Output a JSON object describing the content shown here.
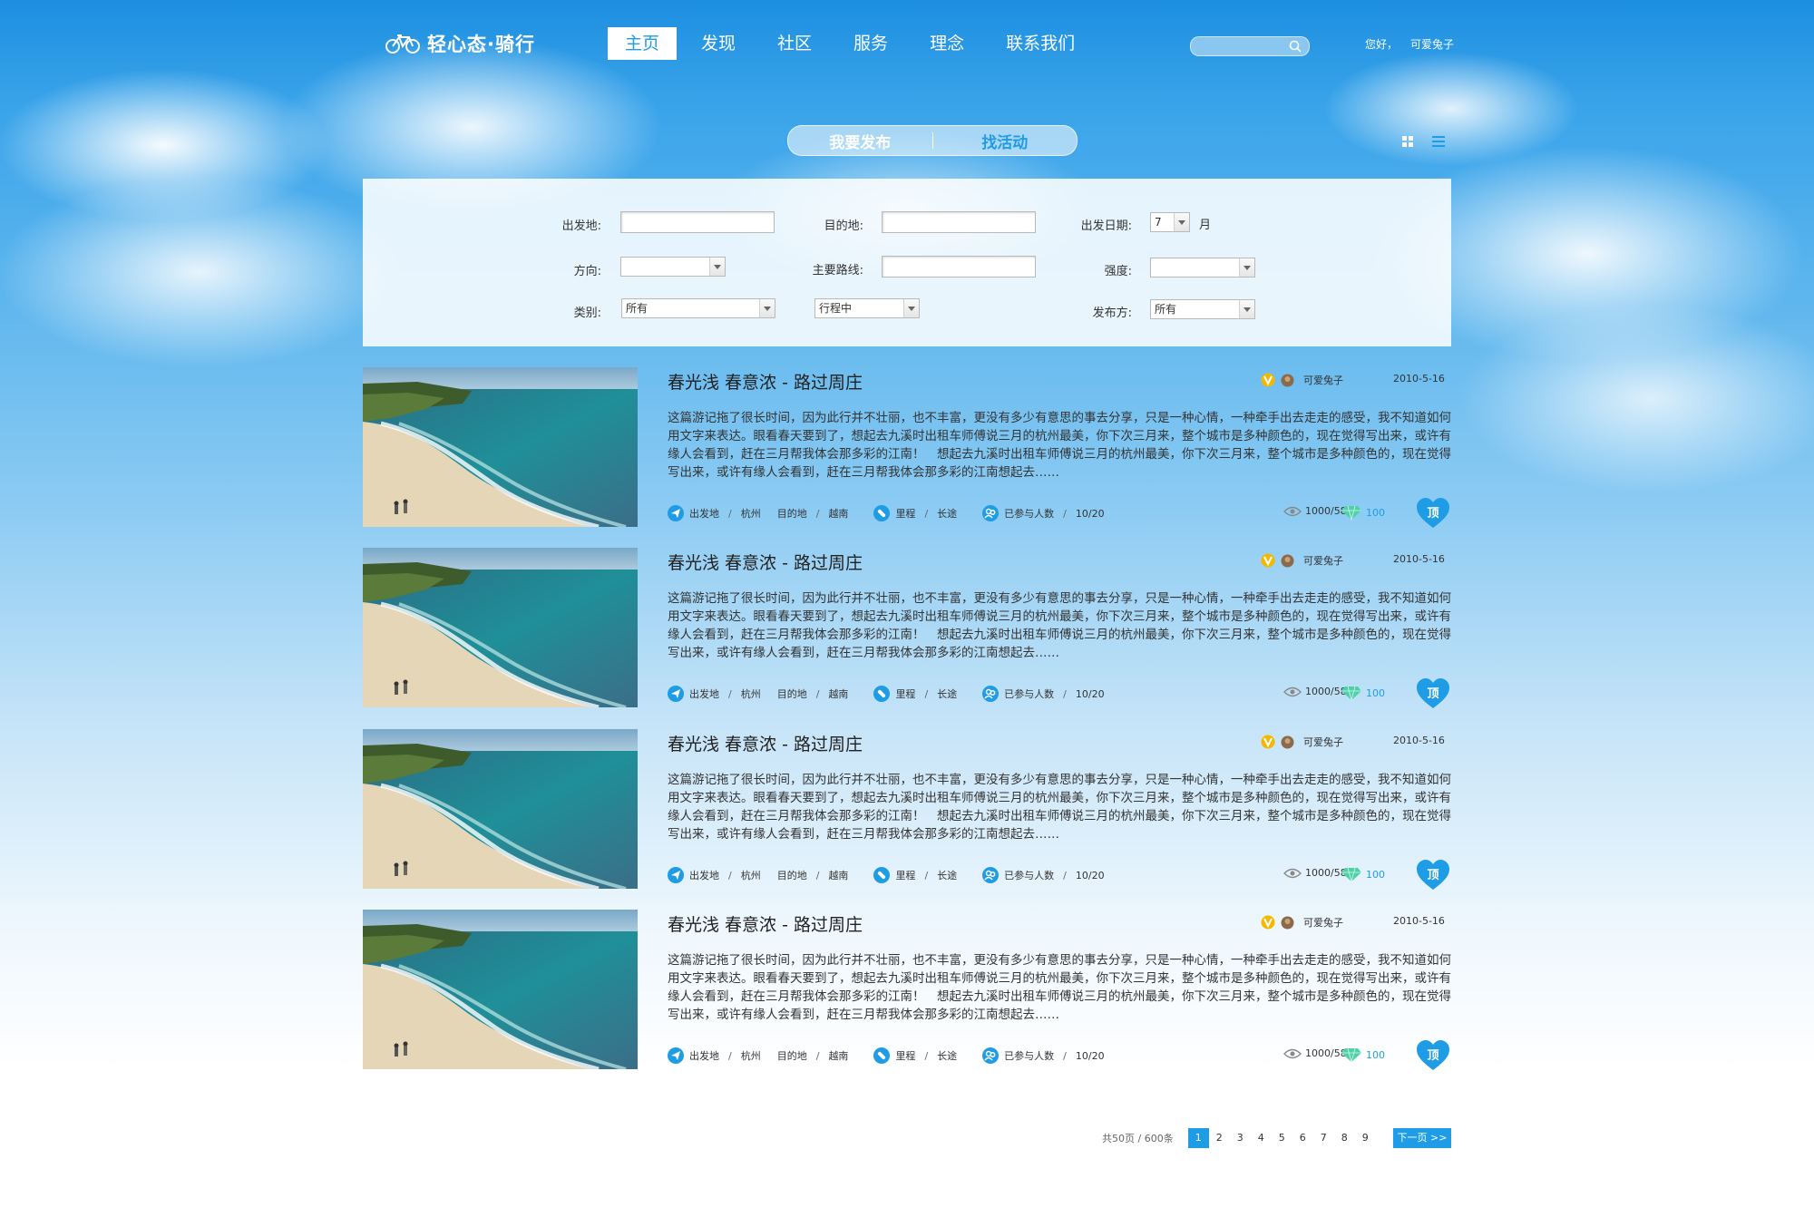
{
  "header": {
    "logo_text": "轻心态·骑行",
    "nav": [
      "主页",
      "发现",
      "社区",
      "服务",
      "理念",
      "联系我们"
    ],
    "search_placeholder": "",
    "greeting": "您好，",
    "username": "可爱兔子"
  },
  "toggle": {
    "publish": "我要发布",
    "find": "找活动"
  },
  "filters": {
    "origin_label": "出发地:",
    "destination_label": "目的地:",
    "date_label": "出发日期:",
    "date_month_value": "7",
    "date_unit": "月",
    "direction_label": "方向:",
    "direction_value": "",
    "route_label": "主要路线:",
    "intensity_label": "强度:",
    "intensity_value": "",
    "category_label": "类别:",
    "category_value": "所有",
    "status_value": "行程中",
    "publisher_label": "发布方:",
    "publisher_value": "所有"
  },
  "posts": [
    {
      "title": "春光浅 春意浓 - 路过周庄",
      "author": "可爱兔子",
      "date": "2010-5-16",
      "desc": "这篇游记拖了很长时间，因为此行并不壮丽，也不丰富，更没有多少有意思的事去分享，只是一种心情，一种牵手出去走走的感受，我不知道如何用文字来表达。眼看春天要到了，想起去九溪时出租车师傅说三月的杭州最美，你下次三月来，整个城市是多种颜色的，现在觉得写出来，或许有缘人会看到，赶在三月帮我体会那多彩的江南！　想起去九溪时出租车师傅说三月的杭州最美，你下次三月来，整个城市是多种颜色的，现在觉得写出来，或许有缘人会看到，赶在三月帮我体会那多彩的江南想起去……",
      "origin_label": "出发地",
      "origin": "杭州",
      "dest_label": "目的地",
      "dest": "越南",
      "distance_label": "里程",
      "distance": "长途",
      "people_label": "已参与人数",
      "people": "10/20",
      "views": "1000/58",
      "gems": "100",
      "top": "顶"
    },
    {
      "title": "春光浅 春意浓 - 路过周庄",
      "author": "可爱兔子",
      "date": "2010-5-16",
      "desc": "这篇游记拖了很长时间，因为此行并不壮丽，也不丰富，更没有多少有意思的事去分享，只是一种心情，一种牵手出去走走的感受，我不知道如何用文字来表达。眼看春天要到了，想起去九溪时出租车师傅说三月的杭州最美，你下次三月来，整个城市是多种颜色的，现在觉得写出来，或许有缘人会看到，赶在三月帮我体会那多彩的江南！　想起去九溪时出租车师傅说三月的杭州最美，你下次三月来，整个城市是多种颜色的，现在觉得写出来，或许有缘人会看到，赶在三月帮我体会那多彩的江南想起去……",
      "origin_label": "出发地",
      "origin": "杭州",
      "dest_label": "目的地",
      "dest": "越南",
      "distance_label": "里程",
      "distance": "长途",
      "people_label": "已参与人数",
      "people": "10/20",
      "views": "1000/58",
      "gems": "100",
      "top": "顶"
    },
    {
      "title": "春光浅 春意浓 - 路过周庄",
      "author": "可爱兔子",
      "date": "2010-5-16",
      "desc": "这篇游记拖了很长时间，因为此行并不壮丽，也不丰富，更没有多少有意思的事去分享，只是一种心情，一种牵手出去走走的感受，我不知道如何用文字来表达。眼看春天要到了，想起去九溪时出租车师傅说三月的杭州最美，你下次三月来，整个城市是多种颜色的，现在觉得写出来，或许有缘人会看到，赶在三月帮我体会那多彩的江南！　想起去九溪时出租车师傅说三月的杭州最美，你下次三月来，整个城市是多种颜色的，现在觉得写出来，或许有缘人会看到，赶在三月帮我体会那多彩的江南想起去……",
      "origin_label": "出发地",
      "origin": "杭州",
      "dest_label": "目的地",
      "dest": "越南",
      "distance_label": "里程",
      "distance": "长途",
      "people_label": "已参与人数",
      "people": "10/20",
      "views": "1000/58",
      "gems": "100",
      "top": "顶"
    },
    {
      "title": "春光浅 春意浓 - 路过周庄",
      "author": "可爱兔子",
      "date": "2010-5-16",
      "desc": "这篇游记拖了很长时间，因为此行并不壮丽，也不丰富，更没有多少有意思的事去分享，只是一种心情，一种牵手出去走走的感受，我不知道如何用文字来表达。眼看春天要到了，想起去九溪时出租车师傅说三月的杭州最美，你下次三月来，整个城市是多种颜色的，现在觉得写出来，或许有缘人会看到，赶在三月帮我体会那多彩的江南！　想起去九溪时出租车师傅说三月的杭州最美，你下次三月来，整个城市是多种颜色的，现在觉得写出来，或许有缘人会看到，赶在三月帮我体会那多彩的江南想起去……",
      "origin_label": "出发地",
      "origin": "杭州",
      "dest_label": "目的地",
      "dest": "越南",
      "distance_label": "里程",
      "distance": "长途",
      "people_label": "已参与人数",
      "people": "10/20",
      "views": "1000/58",
      "gems": "100",
      "top": "顶"
    }
  ],
  "pagination": {
    "summary": "共50页 / 600条",
    "pages": [
      "1",
      "2",
      "3",
      "4",
      "5",
      "6",
      "7",
      "8",
      "9"
    ],
    "current": "1",
    "next": "下一页 >>"
  },
  "colors": {
    "accent": "#1f9ce6",
    "sky_top": "#1d8fe0"
  }
}
